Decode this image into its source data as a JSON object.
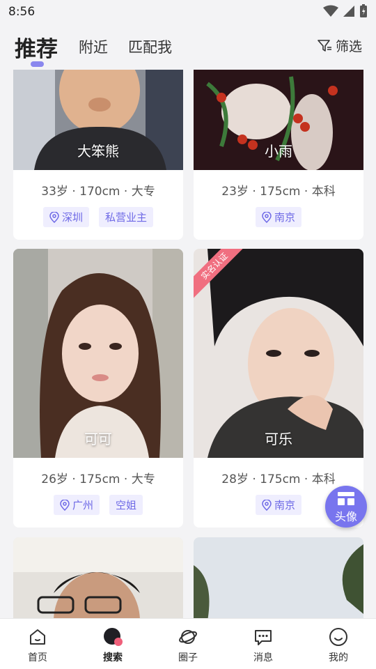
{
  "status": {
    "time": "8:56"
  },
  "nav": {
    "tabs": [
      {
        "label": "推荐",
        "active": true
      },
      {
        "label": "附近",
        "active": false
      },
      {
        "label": "匹配我",
        "active": false
      }
    ],
    "filter_label": "筛选",
    "accent": "#8a87ee"
  },
  "cards": [
    {
      "name": "大笨熊",
      "info": "33岁 · 170cm · 大专",
      "tags": [
        {
          "text": "深圳",
          "icon": "location-icon"
        },
        {
          "text": "私营业主"
        }
      ]
    },
    {
      "name": "小雨",
      "info": "23岁 · 175cm · 本科",
      "tags": [
        {
          "text": "南京",
          "icon": "location-icon"
        }
      ]
    },
    {
      "name": "可可",
      "info": "26岁 · 175cm · 大专",
      "tags": [
        {
          "text": "广州",
          "icon": "location-icon"
        },
        {
          "text": "空姐"
        }
      ]
    },
    {
      "name": "可乐",
      "info": "28岁 · 175cm · 本科",
      "verified_badge": "实名认证",
      "tags": [
        {
          "text": "南京",
          "icon": "location-icon"
        }
      ]
    }
  ],
  "fab": {
    "label": "头像",
    "icon": "grid-icon"
  },
  "bottom_nav": [
    {
      "label": "首页",
      "icon": "home-icon"
    },
    {
      "label": "搜索",
      "icon": "search-dot-icon",
      "active": true
    },
    {
      "label": "圈子",
      "icon": "planet-icon"
    },
    {
      "label": "消息",
      "icon": "chat-icon"
    },
    {
      "label": "我的",
      "icon": "smile-icon"
    }
  ]
}
